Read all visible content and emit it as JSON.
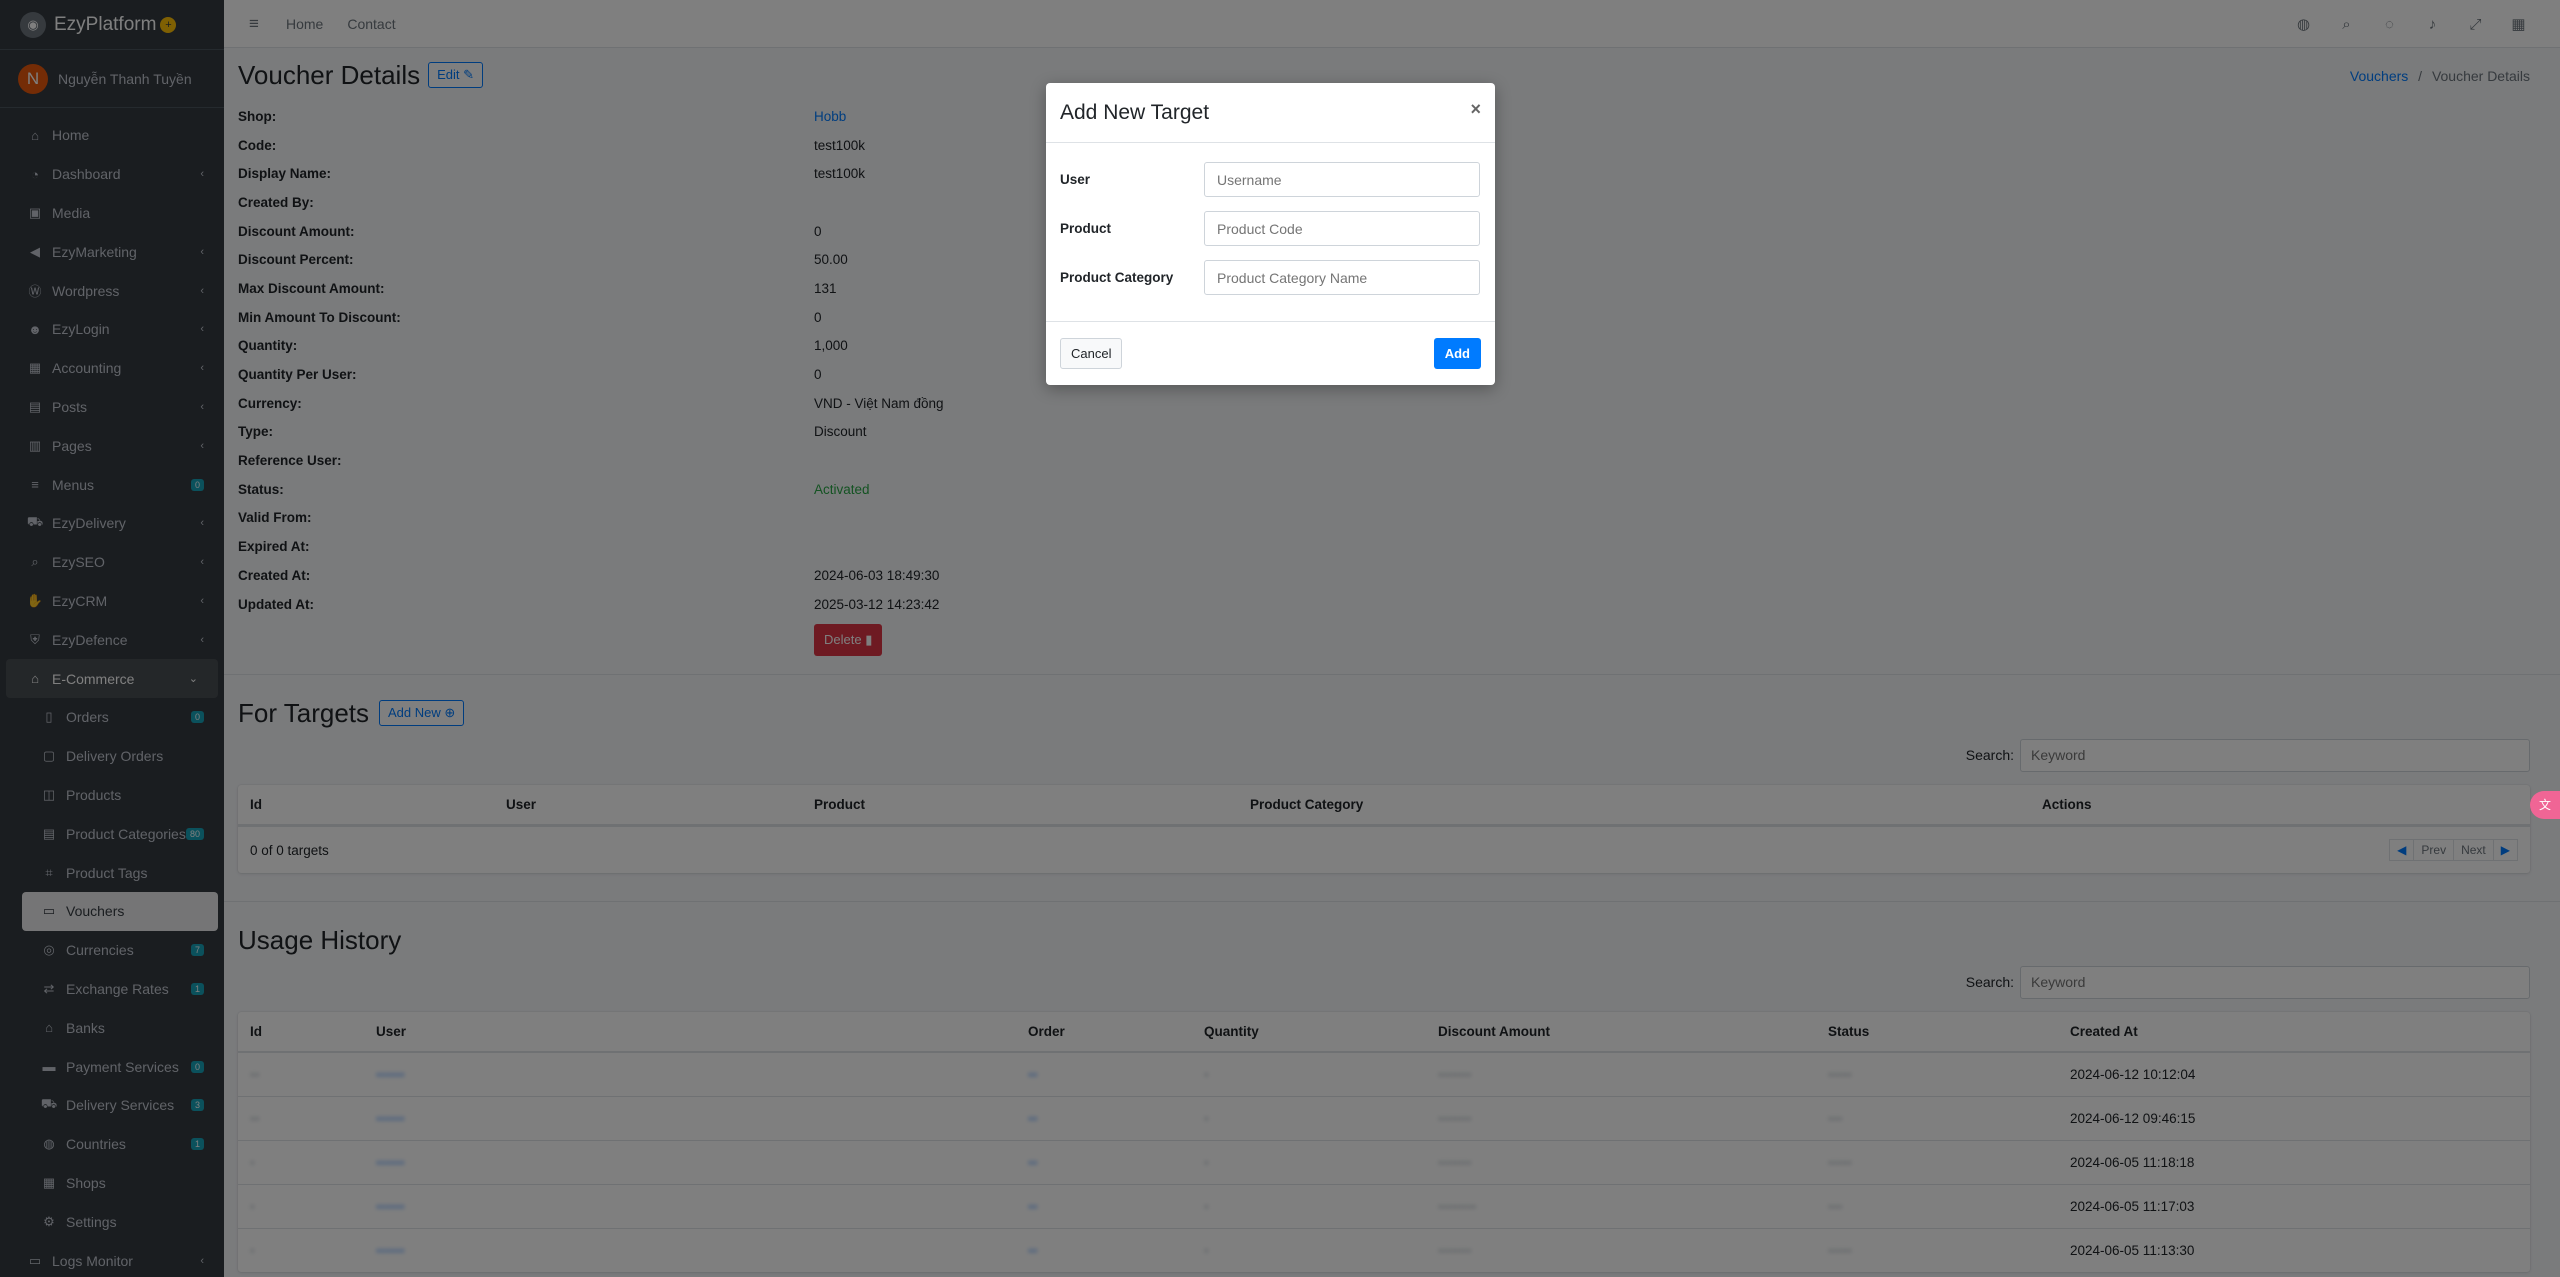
{
  "brand": {
    "name": "EzyPlatform",
    "badge": "+"
  },
  "user": {
    "initial": "N",
    "name": "Nguyễn Thanh Tuyền"
  },
  "sidebar": {
    "items": [
      {
        "label": "Home",
        "icon": "home-icon"
      },
      {
        "label": "Dashboard",
        "icon": "dashboard-icon"
      },
      {
        "label": "Media",
        "icon": "image-icon"
      },
      {
        "label": "EzyMarketing",
        "icon": "megaphone-icon"
      },
      {
        "label": "Wordpress",
        "icon": "wordpress-icon"
      },
      {
        "label": "EzyLogin",
        "icon": "user-lock-icon"
      },
      {
        "label": "Accounting",
        "icon": "calculator-icon"
      },
      {
        "label": "Posts",
        "icon": "posts-icon"
      },
      {
        "label": "Pages",
        "icon": "book-icon"
      },
      {
        "label": "Menus",
        "icon": "menu-icon",
        "badge": "0"
      },
      {
        "label": "EzyDelivery",
        "icon": "truck-icon"
      },
      {
        "label": "EzySEO",
        "icon": "search-icon"
      },
      {
        "label": "EzyCRM",
        "icon": "handshake-icon"
      },
      {
        "label": "EzyDefence",
        "icon": "shield-icon"
      },
      {
        "label": "E-Commerce",
        "icon": "store-icon"
      }
    ],
    "sub_items": [
      {
        "label": "Orders",
        "icon": "clipboard-icon",
        "badge": "0"
      },
      {
        "label": "Delivery Orders",
        "icon": "box-icon"
      },
      {
        "label": "Products",
        "icon": "cube-icon"
      },
      {
        "label": "Product Categories",
        "icon": "list-icon",
        "badge": "80"
      },
      {
        "label": "Product Tags",
        "icon": "tags-icon"
      },
      {
        "label": "Vouchers",
        "icon": "ticket-icon"
      },
      {
        "label": "Currencies",
        "icon": "coins-icon",
        "badge": "7"
      },
      {
        "label": "Exchange Rates",
        "icon": "exchange-icon",
        "badge": "1"
      },
      {
        "label": "Banks",
        "icon": "bank-icon"
      },
      {
        "label": "Payment Services",
        "icon": "wallet-icon",
        "badge": "0"
      },
      {
        "label": "Delivery Services",
        "icon": "truck-icon",
        "badge": "3"
      },
      {
        "label": "Countries",
        "icon": "globe-icon",
        "badge": "1"
      },
      {
        "label": "Shops",
        "icon": "shop-icon"
      },
      {
        "label": "Settings",
        "icon": "gear-icon"
      }
    ],
    "last_item": {
      "label": "Logs Monitor",
      "icon": "monitor-icon"
    }
  },
  "topbar": {
    "links": [
      "Home",
      "Contact"
    ]
  },
  "page": {
    "title": "Voucher Details",
    "edit_label": "Edit",
    "breadcrumb": {
      "parent": "Vouchers",
      "separator": "/",
      "current": "Voucher Details"
    }
  },
  "details": [
    {
      "label": "Shop:",
      "value": "Hobb",
      "style": "link"
    },
    {
      "label": "Code:",
      "value": "test100k"
    },
    {
      "label": "Display Name:",
      "value": "test100k"
    },
    {
      "label": "Created By:",
      "value": ""
    },
    {
      "label": "Discount Amount:",
      "value": "0"
    },
    {
      "label": "Discount Percent:",
      "value": "50.00"
    },
    {
      "label": "Max Discount Amount:",
      "value": "131"
    },
    {
      "label": "Min Amount To Discount:",
      "value": "0"
    },
    {
      "label": "Quantity:",
      "value": "1,000"
    },
    {
      "label": "Quantity Per User:",
      "value": "0"
    },
    {
      "label": "Currency:",
      "value": "VND - Việt Nam đồng"
    },
    {
      "label": "Type:",
      "value": "Discount"
    },
    {
      "label": "Reference User:",
      "value": ""
    },
    {
      "label": "Status:",
      "value": "Activated",
      "style": "green"
    },
    {
      "label": "Valid From:",
      "value": ""
    },
    {
      "label": "Expired At:",
      "value": ""
    },
    {
      "label": "Created At:",
      "value": "2024-06-03 18:49:30"
    },
    {
      "label": "Updated At:",
      "value": "2025-03-12 14:23:42"
    }
  ],
  "delete_label": "Delete",
  "targets": {
    "title": "For Targets",
    "add_label": "Add New",
    "search_label": "Search:",
    "search_placeholder": "Keyword",
    "columns": [
      "Id",
      "User",
      "Product",
      "Product Category",
      "Actions"
    ],
    "summary": "0 of 0 targets",
    "prev": "Prev",
    "next": "Next"
  },
  "usage": {
    "title": "Usage History",
    "search_label": "Search:",
    "search_placeholder": "Keyword",
    "columns": [
      "Id",
      "User",
      "Order",
      "Quantity",
      "Discount Amount",
      "Status",
      "Created At"
    ],
    "rows": [
      {
        "created_at": "2024-06-12 10:12:04"
      },
      {
        "created_at": "2024-06-12 09:46:15"
      },
      {
        "created_at": "2024-06-05 11:18:18"
      },
      {
        "created_at": "2024-06-05 11:17:03"
      },
      {
        "created_at": "2024-06-05 11:13:30"
      }
    ]
  },
  "modal": {
    "title": "Add New Target",
    "close": "×",
    "fields": [
      {
        "label": "User",
        "placeholder": "Username"
      },
      {
        "label": "Product",
        "placeholder": "Product Code"
      },
      {
        "label": "Product Category",
        "placeholder": "Product Category Name"
      }
    ],
    "cancel_label": "Cancel",
    "add_label": "Add"
  },
  "colors": {
    "primary": "#007bff",
    "danger": "#dc3545",
    "success": "#28a745",
    "sidebar": "#343a40"
  }
}
